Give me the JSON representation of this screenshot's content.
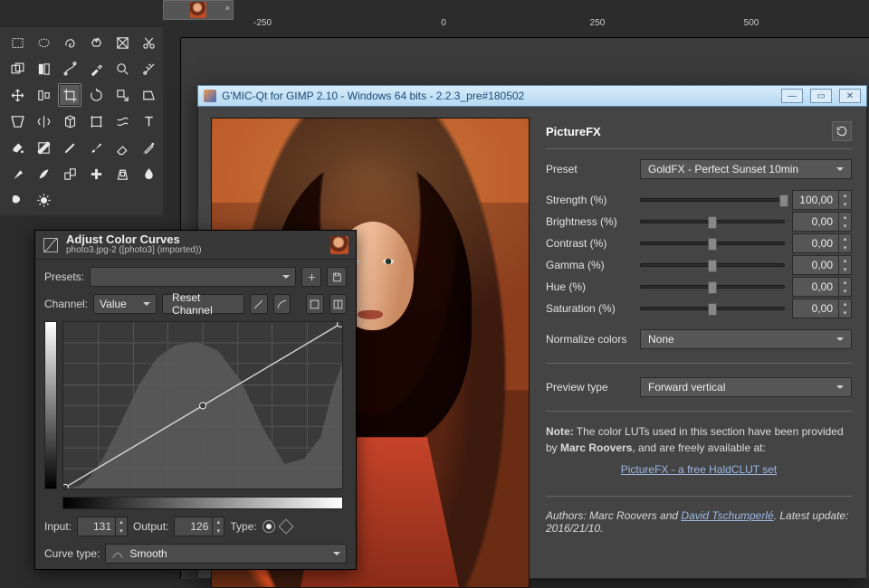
{
  "tabs": {
    "close_glyph": "×"
  },
  "ruler": {
    "marks": [
      "-250",
      "0",
      "250",
      "500"
    ]
  },
  "toolbox": {
    "tools": [
      "rect-select",
      "ellipse-select",
      "free-select",
      "fuzzy-select",
      "color-select",
      "intelligent-scissors",
      "foreground-select",
      "bycolor",
      "paths",
      "color-picker",
      "zoom",
      "measure",
      "move",
      "align",
      "crop",
      "rotate",
      "scale",
      "shear",
      "perspective",
      "flip",
      "cage",
      "unified-transform",
      "warp",
      "text",
      "bucket-fill",
      "blend",
      "pencil",
      "paintbrush",
      "eraser",
      "airbrush",
      "ink",
      "mypaint",
      "clone",
      "heal",
      "perspective-clone",
      "blur-sharpen",
      "smudge",
      "dodge-burn"
    ],
    "selected_index": 14
  },
  "curves": {
    "title": "Adjust Color Curves",
    "subtitle": "photo3.jpg-2 ([photo3] (imported))",
    "presets_label": "Presets:",
    "presets_value": "",
    "channel_label": "Channel:",
    "channel_value": "Value",
    "reset_channel": "Reset Channel",
    "input_label": "Input:",
    "input_value": "131",
    "output_label": "Output:",
    "output_value": "126",
    "type_label": "Type:",
    "curve_type_label": "Curve type:",
    "curve_type_value": "Smooth"
  },
  "gmic": {
    "window_title": "G'MIC-Qt for GIMP 2.10 - Windows 64 bits - 2.2.3_pre#180502",
    "section_title": "PictureFX",
    "preset_label": "Preset",
    "preset_value": "GoldFX - Perfect Sunset 10min",
    "params": [
      {
        "key": "strength",
        "label": "Strength (%)",
        "value": "100,00",
        "pos": 100
      },
      {
        "key": "brightness",
        "label": "Brightness (%)",
        "value": "0,00",
        "pos": 50
      },
      {
        "key": "contrast",
        "label": "Contrast (%)",
        "value": "0,00",
        "pos": 50
      },
      {
        "key": "gamma",
        "label": "Gamma (%)",
        "value": "0,00",
        "pos": 50
      },
      {
        "key": "hue",
        "label": "Hue (%)",
        "value": "0,00",
        "pos": 50
      },
      {
        "key": "saturation",
        "label": "Saturation (%)",
        "value": "0,00",
        "pos": 50
      }
    ],
    "normalize_label": "Normalize colors",
    "normalize_value": "None",
    "preview_label": "Preview type",
    "preview_value": "Forward vertical",
    "note_prefix": "Note:",
    "note_text1": " The color LUTs used in this section have been provided by ",
    "note_author": "Marc Roovers",
    "note_text2": ", and are freely available at:",
    "note_link": "PictureFX - a free HaldCLUT set",
    "authors_label": "Authors: ",
    "author1": "Marc Roovers",
    "authors_and": " and ",
    "author2": "David Tschumperlé",
    "authors_tail": ". Latest update: ",
    "authors_date": "2016/21/10",
    "authors_dot": "."
  }
}
